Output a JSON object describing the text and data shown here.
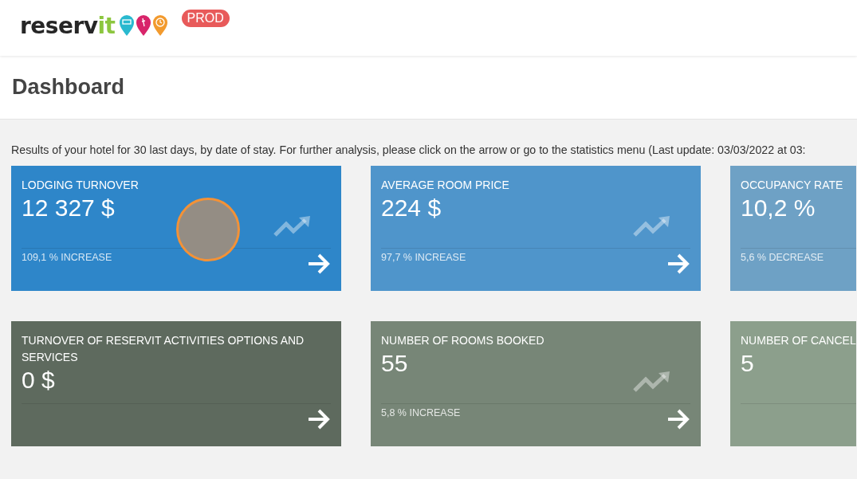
{
  "header": {
    "logo": {
      "text_dark": "reserv",
      "text_accent": "it"
    },
    "env_badge": "PROD"
  },
  "page_title": "Dashboard",
  "intro": "Results of your hotel for 30 last days, by date of stay. For further analysis, please click on the arrow or go to the statistics menu (Last update: 03/03/2022 at 03:",
  "click_marker": true,
  "cards": [
    {
      "title": "LODGING TURNOVER",
      "value": "12 327 $",
      "change": "109,1 % INCREASE",
      "color": "#2e86c9",
      "trend": true,
      "arrow": true
    },
    {
      "title": "AVERAGE ROOM PRICE",
      "value": "224 $",
      "change": "97,7 % INCREASE",
      "color": "#4f95cb",
      "trend": true,
      "arrow": true
    },
    {
      "title": "OCCUPANCY RATE",
      "value": "10,2 %",
      "change": "5,6 % DECREASE",
      "color": "#6ea1c5",
      "trend": false,
      "arrow": false
    },
    {
      "title": "TURNOVER OF RESERVIT ACTIVITIES OPTIONS AND SERVICES",
      "value": "0 $",
      "color": "#5e6a5e",
      "trend": false,
      "arrow": true
    },
    {
      "title": "NUMBER OF ROOMS BOOKED",
      "value": "55",
      "change": "5,8 % INCREASE",
      "color": "#778677",
      "trend": true,
      "arrow": true
    },
    {
      "title": "NUMBER OF CANCEL",
      "value": "5",
      "color": "#8c9f8c",
      "trend": false,
      "arrow": false
    }
  ]
}
